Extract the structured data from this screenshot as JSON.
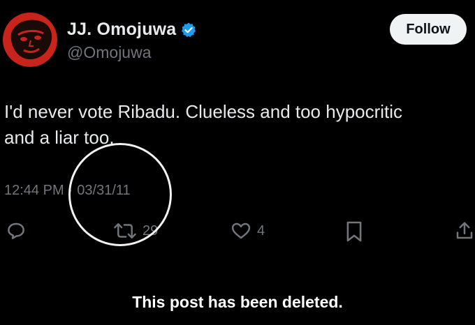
{
  "user": {
    "display_name": "JJ. Omojuwa",
    "handle": "@Omojuwa",
    "verified": true,
    "avatar_icon": "profile-avatar"
  },
  "follow_label": "Follow",
  "tweet": {
    "text_line1": "I'd never vote Ribadu. Clueless and too hypocritic",
    "text_line2": "and a liar too.",
    "time": "12:44 PM",
    "separator": "·",
    "date": "03/31/11"
  },
  "actions": {
    "reply_icon": "reply-icon",
    "retweet_icon": "retweet-icon",
    "retweet_count": "29",
    "like_icon": "heart-icon",
    "like_count": "4",
    "bookmark_icon": "bookmark-icon",
    "share_icon": "share-icon"
  },
  "notice": "This post has been deleted.",
  "colors": {
    "background": "#000000",
    "text": "#e7e9ea",
    "muted": "#71767b",
    "verified": "#1d9bf0",
    "follow_bg": "#eff3f4"
  }
}
